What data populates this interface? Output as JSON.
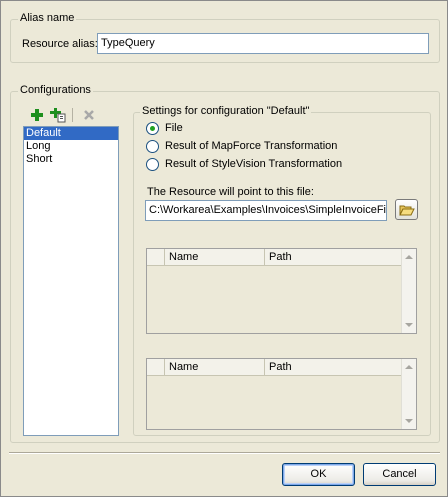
{
  "alias_group": {
    "title": "Alias name",
    "resource_alias_label": "Resource alias:",
    "resource_alias_value": "TypeQuery"
  },
  "configurations_group": {
    "title": "Configurations",
    "toolbar": {
      "add_icon": "add-config-icon",
      "copy_icon": "copy-config-icon",
      "delete_icon": "delete-config-icon"
    },
    "items": [
      "Default",
      "Long",
      "Short"
    ],
    "selected": "Default"
  },
  "settings": {
    "title": "Settings for configuration \"Default\"",
    "options": [
      "File",
      "Result of MapForce Transformation",
      "Result of StyleVision Transformation"
    ],
    "selected_option": "File",
    "point_label": "The Resource will point to this file:",
    "file_path": "C:\\Workarea\\Examples\\Invoices\\SimpleInvoiceFi",
    "grid1": {
      "col1": "Name",
      "col2": "Path"
    },
    "grid2": {
      "col1": "Name",
      "col2": "Path"
    }
  },
  "buttons": {
    "ok": "OK",
    "cancel": "Cancel"
  },
  "colors": {
    "selection": "#316ac5",
    "add_green": "#1e8f1e",
    "radio_dot": "#21a121"
  }
}
